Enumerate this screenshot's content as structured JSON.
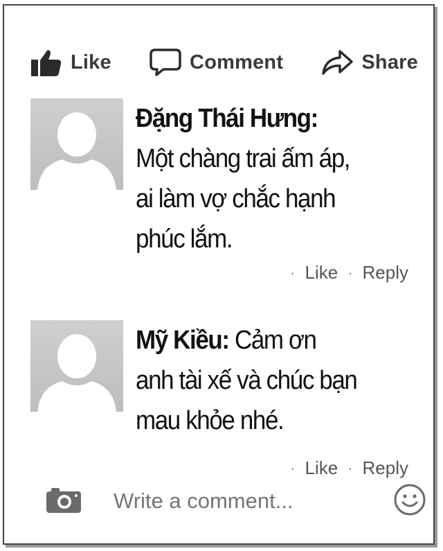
{
  "actions": {
    "like_label": "Like",
    "comment_label": "Comment",
    "share_label": "Share"
  },
  "comments": [
    {
      "author": "Đặng Thái Hưng",
      "separator": ":",
      "lines": [
        "Một chàng trai ấm áp,",
        "ai làm vợ chắc hạnh",
        "phúc lắm."
      ],
      "like_label": "Like",
      "reply_label": "Reply"
    },
    {
      "author": "Mỹ Kiều",
      "separator": ":",
      "lines": [
        "Cảm ơn",
        "anh tài xế và chúc bạn",
        "mau khỏe nhé."
      ],
      "like_label": "Like",
      "reply_label": "Reply"
    }
  ],
  "composer": {
    "placeholder": "Write a comment..."
  },
  "colors": {
    "icon": "#2b2b2b",
    "avatar_bg": "#c4c4c4",
    "meta_text": "#555555",
    "placeholder_text": "#8a8a8a"
  },
  "icons": [
    "thumbs-up-icon",
    "speech-bubble-icon",
    "share-arrow-icon",
    "camera-icon",
    "smiley-icon"
  ]
}
